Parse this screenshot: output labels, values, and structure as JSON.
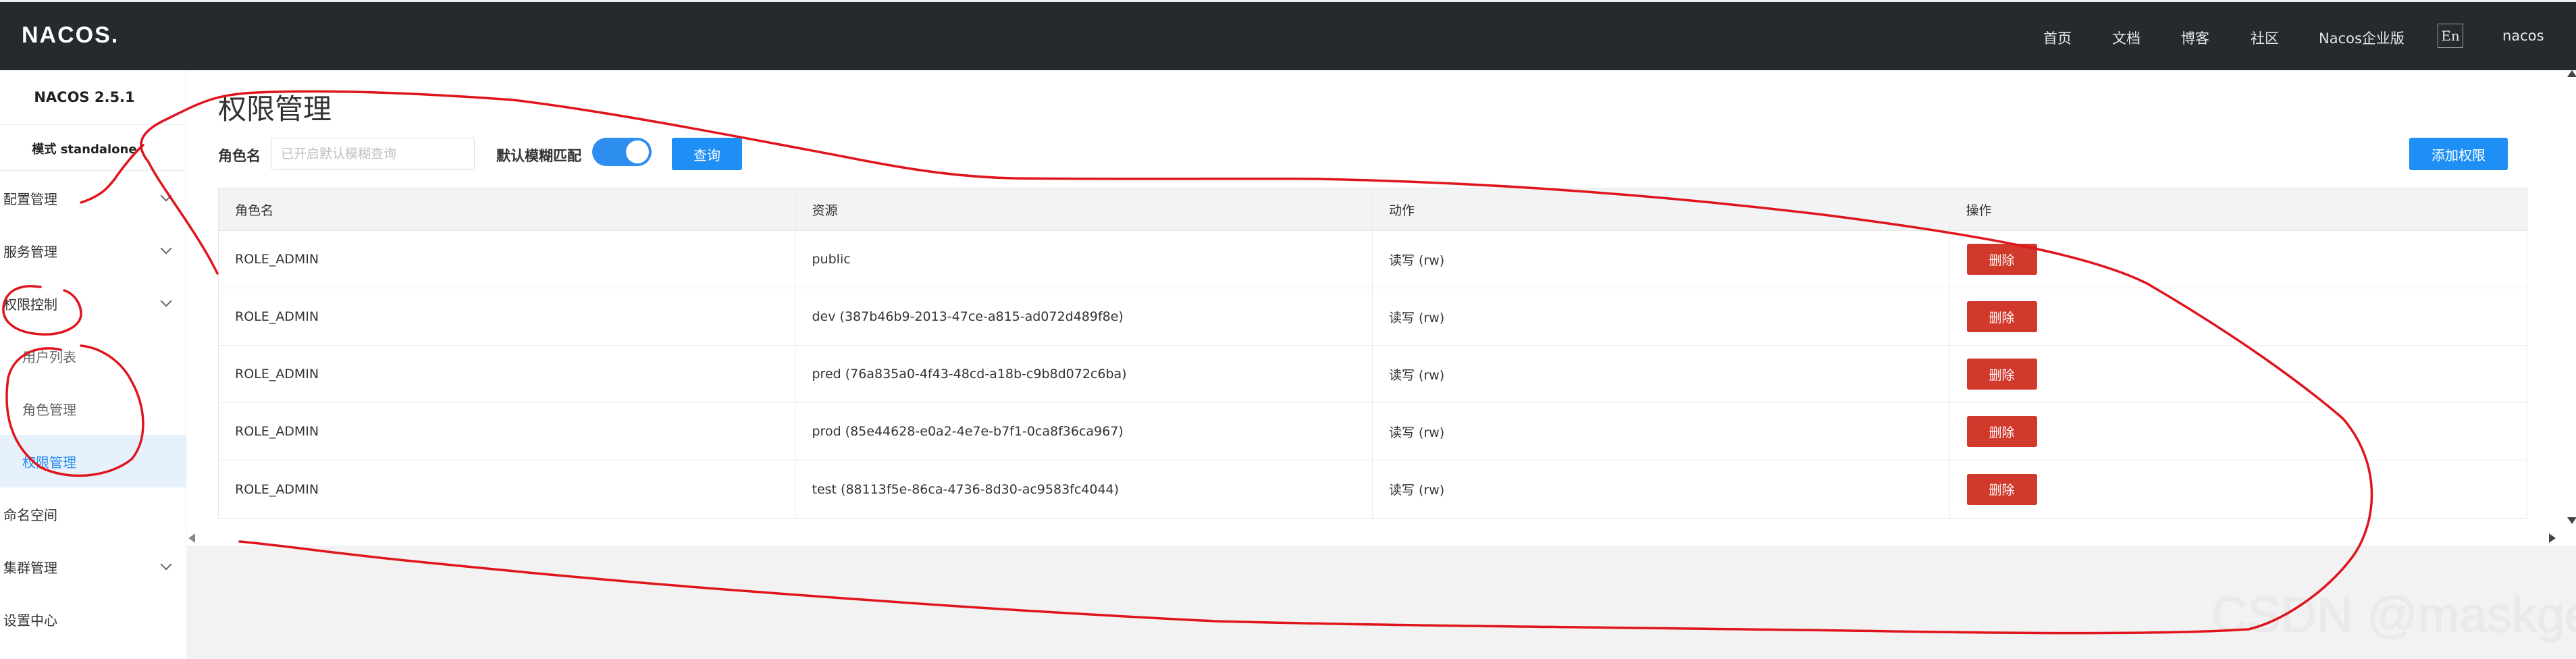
{
  "colors": {
    "topbar_bg": "#252a2f",
    "accent": "#2e8ef0",
    "danger": "#d0392b",
    "annotation_ink": "#e0141c"
  },
  "header": {
    "logo": "NACOS.",
    "nav": [
      "首页",
      "文档",
      "博客",
      "社区",
      "Nacos企业版"
    ],
    "lang_button": "En",
    "user": "nacos"
  },
  "sidebar": {
    "version": "NACOS 2.5.1",
    "mode": "模式 standalone",
    "menu": [
      {
        "label": "配置管理",
        "expandable": true
      },
      {
        "label": "服务管理",
        "expandable": true
      },
      {
        "label": "权限控制",
        "expandable": true,
        "expanded": true
      },
      {
        "label": "命名空间",
        "expandable": false
      },
      {
        "label": "集群管理",
        "expandable": true
      },
      {
        "label": "设置中心",
        "expandable": false
      }
    ],
    "submenu": [
      {
        "label": "用户列表",
        "active": false
      },
      {
        "label": "角色管理",
        "active": false
      },
      {
        "label": "权限管理",
        "active": true
      }
    ]
  },
  "page": {
    "title": "权限管理",
    "role_label": "角色名",
    "role_placeholder": "已开启默认模糊查询",
    "fuzzy_label": "默认模糊匹配",
    "fuzzy_enabled": true,
    "query_button": "查询",
    "add_button": "添加权限"
  },
  "table": {
    "columns": [
      "角色名",
      "资源",
      "动作",
      "操作"
    ],
    "rows": [
      {
        "role": "ROLE_ADMIN",
        "resource": "public",
        "action": "读写 (rw)",
        "op": "删除"
      },
      {
        "role": "ROLE_ADMIN",
        "resource": "dev (387b46b9-2013-47ce-a815-ad072d489f8e)",
        "action": "读写 (rw)",
        "op": "删除"
      },
      {
        "role": "ROLE_ADMIN",
        "resource": "pred (76a835a0-4f43-48cd-a18b-c9b8d072c6ba)",
        "action": "读写 (rw)",
        "op": "删除"
      },
      {
        "role": "ROLE_ADMIN",
        "resource": "prod (85e44628-e0a2-4e7e-b7f1-0ca8f36ca967)",
        "action": "读写 (rw)",
        "op": "删除"
      },
      {
        "role": "ROLE_ADMIN",
        "resource": "test (88113f5e-86ca-4736-8d30-ac9583fc4044)",
        "action": "读写 (rw)",
        "op": "删除"
      }
    ]
  },
  "watermark": "CSDN @maskge"
}
